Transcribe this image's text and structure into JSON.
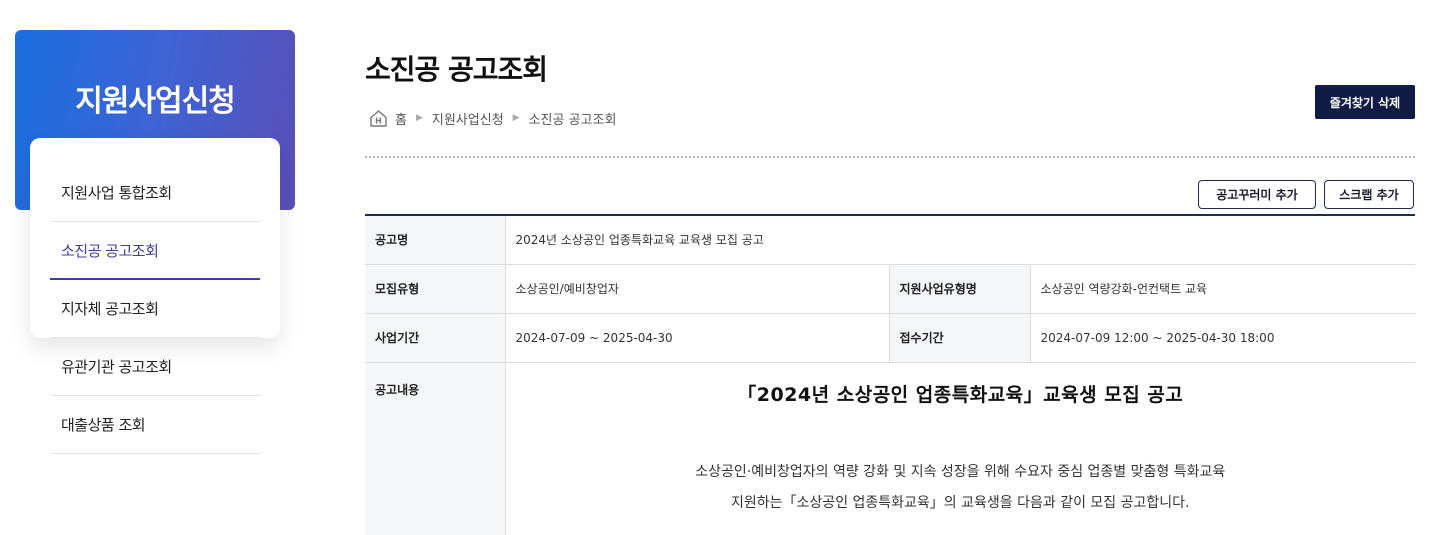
{
  "sidebar": {
    "title": "지원사업신청",
    "items": [
      {
        "label": "지원사업 통합조회"
      },
      {
        "label": "소진공 공고조회"
      },
      {
        "label": "지자체 공고조회"
      },
      {
        "label": "유관기관 공고조회"
      },
      {
        "label": "대출상품 조회"
      }
    ],
    "active_index": 1
  },
  "header": {
    "title": "소진공 공고조회",
    "breadcrumb": [
      "홈",
      "지원사업신청",
      "소진공 공고조회"
    ],
    "favorite_remove_label": "즐겨찾기 삭제"
  },
  "actions": {
    "add_bundle_label": "공고꾸러미 추가",
    "add_scrap_label": "스크랩 추가"
  },
  "table": {
    "announcement_name_label": "공고명",
    "announcement_name": "2024년 소상공인 업종특화교육 교육생 모집 공고",
    "recruit_type_label": "모집유형",
    "recruit_type": "소상공인/예비창업자",
    "support_type_label": "지원사업유형명",
    "support_type": "소상공인 역량강화-언컨택트 교육",
    "period_label": "사업기간",
    "period": "2024-07-09 ~ 2025-04-30",
    "reception_label": "접수기간",
    "reception": "2024-07-09 12:00 ~ 2025-04-30 18:00",
    "content_label": "공고내용",
    "content": {
      "heading": "「2024년 소상공인 업종특화교육」교육생 모집 공고",
      "line1": "소상공인·예비창업자의 역량 강화 및 지속 성장을 위해 수요자 중심 업종별 맞춤형 특화교육",
      "line2": "지원하는「소상공인 업종특화교육」의 교육생을 다음과 같이 모집 공고합니다."
    }
  },
  "colors": {
    "banner_start": "#1a6fe0",
    "banner_end": "#5a4fb8",
    "active_menu": "#3c3f9c",
    "navy": "#101c45"
  }
}
